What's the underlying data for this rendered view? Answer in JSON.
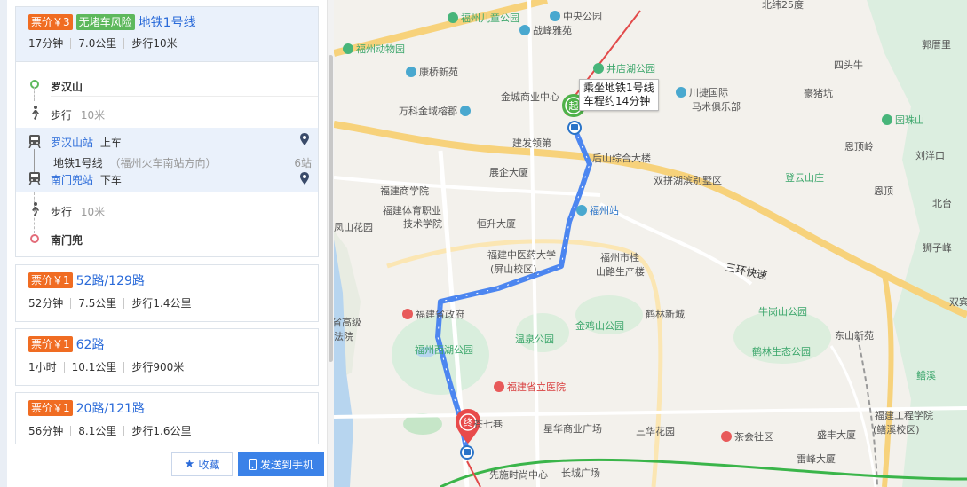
{
  "routes": [
    {
      "fare": "票价￥3",
      "risk": "无堵车风险",
      "name": "地铁1号线",
      "duration": "17分钟",
      "distance": "7.0公里",
      "walk": "步行10米",
      "steps": {
        "start": "罗汉山",
        "walk1": "步行",
        "walk1_dist": "10米",
        "board_station": "罗汉山站",
        "board_action": "上车",
        "line": "地铁1号线",
        "direction": "（福州火车南站方向）",
        "stops": "6站",
        "alight_station": "南门兜站",
        "alight_action": "下车",
        "walk2": "步行",
        "walk2_dist": "10米",
        "end": "南门兜"
      }
    },
    {
      "fare": "票价￥1",
      "name": "52路/129路",
      "duration": "52分钟",
      "distance": "7.5公里",
      "walk": "步行1.4公里"
    },
    {
      "fare": "票价￥1",
      "name": "62路",
      "duration": "1小时",
      "distance": "10.1公里",
      "walk": "步行900米"
    },
    {
      "fare": "票价￥1",
      "name": "20路/121路",
      "duration": "56分钟",
      "distance": "8.1公里",
      "walk": "步行1.6公里"
    }
  ],
  "actions": {
    "favorite": "收藏",
    "send_to_phone": "发送到手机"
  },
  "map": {
    "tooltip_line1": "乘坐地铁1号线",
    "tooltip_line2": "车程约14分钟",
    "start_marker": "起",
    "end_marker": "终",
    "highway": "三环快速",
    "labels": {
      "beiwei": "北纬25度",
      "ertong": "福州儿童公园",
      "zhongyang": "中央公园",
      "zhanling": "战峰雅苑",
      "dongwuyuan": "福州动物园",
      "kangqiao": "康桥新苑",
      "jiandian": "井店湖公园",
      "jincheng": "金城商业中心",
      "wanke": "万科金域榕郡",
      "chuanjie": "川捷国际",
      "mashu": "马术俱乐部",
      "haozhu": "豪猪坑",
      "sitou": "四头牛",
      "guoshu": "郭厝里",
      "yuanzhu": "园珠山",
      "ending": "恩顶岭",
      "liuyang": "刘洋口",
      "jianfa": "建发领第",
      "houshan": "后山综合大楼",
      "zhanqi": "展企大厦",
      "shuangpin": "双拼湖滨别墅区",
      "dengyun": "登云山庄",
      "enting": "恩顶",
      "shangxue": "福建商学院",
      "tiyu1": "福建体育职业",
      "tiyu2": "技术学院",
      "hengxin": "恒升大厦",
      "fuzhouzhan": "福州站",
      "fengshan": "凤山花园",
      "zhongyi1": "福建中医药大学",
      "zhongyi2": "(屏山校区)",
      "shigui1": "福州市桂",
      "shigui2": "山路生产楼",
      "beitai": "北台",
      "shizi": "狮子峰",
      "zhengfu": "福建省政府",
      "gaoji1": "省高级",
      "gaoji2": "法院",
      "wenquan": "温泉公园",
      "jinji": "金鸡山公园",
      "helin": "鹤林新城",
      "niugang": "牛岗山公园",
      "shuangbin": "双宾",
      "xihu": "福州西湖公园",
      "helinshengtai": "鹤林生态公园",
      "dongshan": "东山新苑",
      "lixi": "鳝溪",
      "shengli": "福建省立医院",
      "qiqi": "苍七巷",
      "xinghua": "星华商业广场",
      "sanhua": "三华花园",
      "chahui": "茶会社区",
      "shengfeng": "盛丰大厦",
      "gongcheng1": "福建工程学院",
      "gongcheng2": "(鳝溪校区)",
      "leifeng": "雷峰大厦",
      "xianshi": "先施时尚中心",
      "changcheng": "长城广场"
    }
  }
}
